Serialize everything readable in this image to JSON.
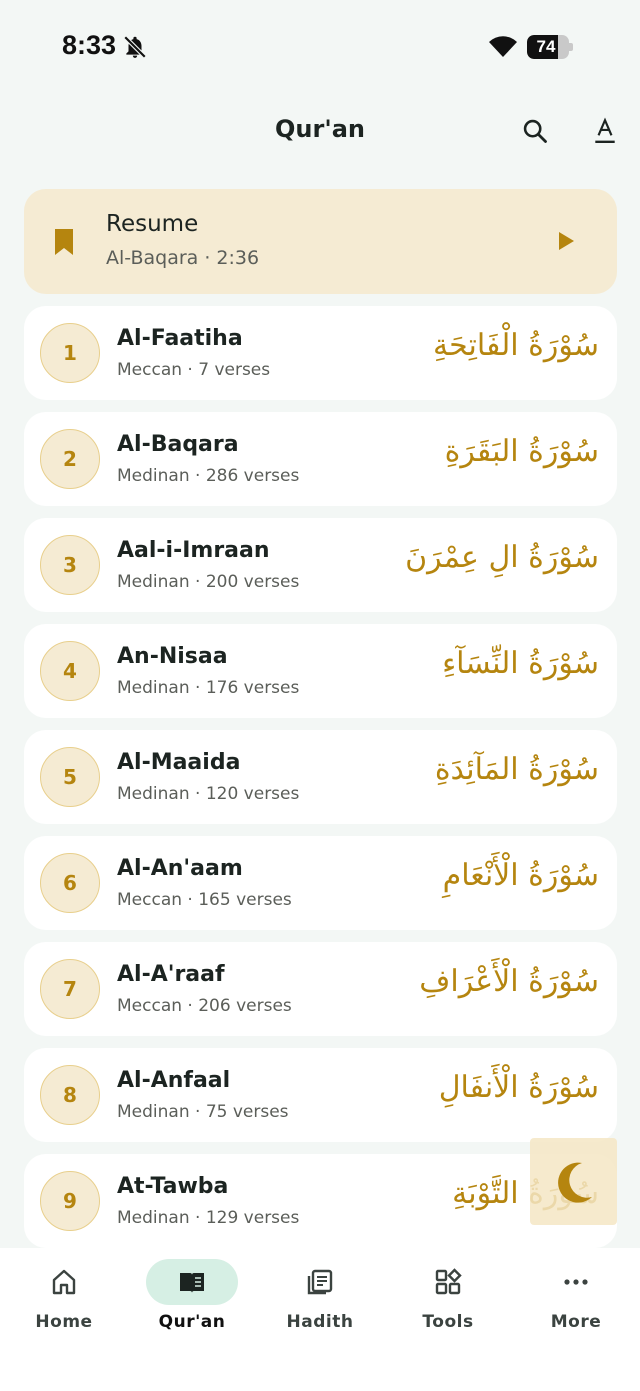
{
  "status_bar": {
    "time": "8:33",
    "battery_level": "74",
    "battery_fraction": 0.74
  },
  "header": {
    "title": "Qur'an",
    "search_icon": "search-icon",
    "font_size_icon": "text-format-icon"
  },
  "resume": {
    "title": "Resume",
    "subtitle": "Al-Baqara · 2:36",
    "bookmark_icon": "bookmark-icon",
    "play_icon": "play-icon"
  },
  "surahs": [
    {
      "number": "1",
      "name": "Al-Faatiha",
      "meta": "Meccan · 7 verses",
      "arabic": "سُوْرَةُ الْفَاتِحَةِ"
    },
    {
      "number": "2",
      "name": "Al-Baqara",
      "meta": "Medinan · 286 verses",
      "arabic": "سُوْرَةُ البَقَرَةِ"
    },
    {
      "number": "3",
      "name": "Aal-i-Imraan",
      "meta": "Medinan · 200 verses",
      "arabic": "سُوْرَةُ الِ عِمْرَنَ"
    },
    {
      "number": "4",
      "name": "An-Nisaa",
      "meta": "Medinan · 176 verses",
      "arabic": "سُوْرَةُ النِّسَآءِ"
    },
    {
      "number": "5",
      "name": "Al-Maaida",
      "meta": "Medinan · 120 verses",
      "arabic": "سُوْرَةُ المَآئِدَةِ"
    },
    {
      "number": "6",
      "name": "Al-An'aam",
      "meta": "Meccan · 165 verses",
      "arabic": "سُوْرَةُ الْأَنْعَامِ"
    },
    {
      "number": "7",
      "name": "Al-A'raaf",
      "meta": "Meccan · 206 verses",
      "arabic": "سُوْرَةُ الْأَعْرَافِ"
    },
    {
      "number": "8",
      "name": "Al-Anfaal",
      "meta": "Medinan · 75 verses",
      "arabic": "سُوْرَةُ الْأَنفَالِ"
    },
    {
      "number": "9",
      "name": "At-Tawba",
      "meta": "Medinan · 129 verses",
      "arabic": "سُوْرَةُ التَّوْبَةِ"
    }
  ],
  "theme_toggle": {
    "icon": "crescent-moon-icon"
  },
  "bottom_nav": {
    "items": [
      {
        "label": "Home",
        "icon": "home-icon",
        "active": false
      },
      {
        "label": "Qur'an",
        "icon": "book-icon",
        "active": true
      },
      {
        "label": "Hadith",
        "icon": "article-icon",
        "active": false
      },
      {
        "label": "Tools",
        "icon": "grid-tools-icon",
        "active": false
      },
      {
        "label": "More",
        "icon": "more-dots-icon",
        "active": false
      }
    ]
  },
  "colors": {
    "accent_gold": "#b5850f",
    "resume_bg": "#f5ebd3",
    "nav_active_bg": "#d6efe4",
    "page_bg": "#f3f7f5"
  }
}
